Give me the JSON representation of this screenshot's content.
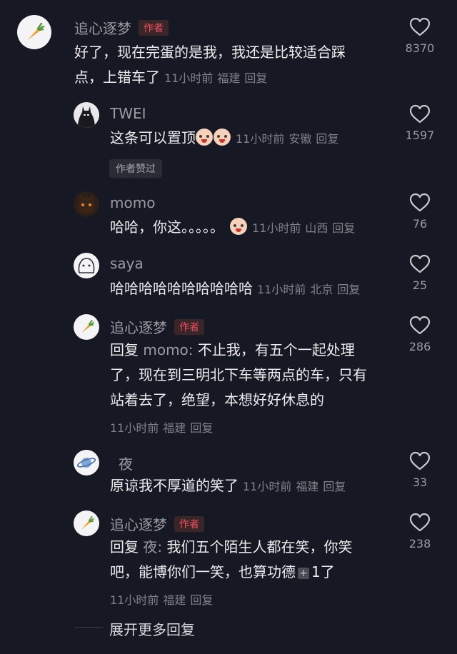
{
  "comments": [
    {
      "user": "追心逐梦",
      "badge": "作者",
      "lines": [
        "好了，现在完蛋的是我，我还是比较适合踩",
        "点，上错车了"
      ],
      "time": "11小时前",
      "location": "福建",
      "reply_label": "回复",
      "likes": "8370"
    },
    {
      "user": "TWEI",
      "text": "这条可以置顶",
      "emojis": [
        "crying-laughing",
        "crying-laughing"
      ],
      "time": "11小时前",
      "location": "安徽",
      "reply_label": "回复",
      "likes": "1597",
      "author_liked": "作者赞过"
    },
    {
      "user": "momo",
      "text": "哈哈，你这。。。。。",
      "emojis": [
        "crying-laughing"
      ],
      "time": "11小时前",
      "location": "山西",
      "reply_label": "回复",
      "likes": "76"
    },
    {
      "user": "saya",
      "text": "哈哈哈哈哈哈哈哈哈哈",
      "time": "11小时前",
      "location": "北京",
      "reply_label": "回复",
      "likes": "25"
    },
    {
      "user": "追心逐梦",
      "badge": "作者",
      "reply_prefix": "回复",
      "reply_to": "momo:",
      "line1": "不止我，有五个一起处理",
      "line2": "了，现在到三明北下车等两点的车，只有",
      "line3": "站着去了，绝望，本想好好休息的",
      "time": "11小时前",
      "location": "福建",
      "reply_label": "回复",
      "likes": "286"
    },
    {
      "user": "夜",
      "text": "原谅我不厚道的笑了",
      "time": "11小时前",
      "location": "福建",
      "reply_label": "回复",
      "likes": "33"
    },
    {
      "user": "追心逐梦",
      "badge": "作者",
      "reply_prefix": "回复",
      "reply_to": "夜:",
      "line1": "我们五个陌生人都在笑，你笑",
      "line2a": "吧，能博你们一笑，也算功德",
      "plus": "+",
      "line2b": "1了",
      "time": "11小时前",
      "location": "福建",
      "reply_label": "回复",
      "likes": "238"
    }
  ],
  "expand_label": "展开更多回复",
  "colors": {
    "background": "#161823",
    "author_badge": "#f25061",
    "muted": "#80818a"
  }
}
